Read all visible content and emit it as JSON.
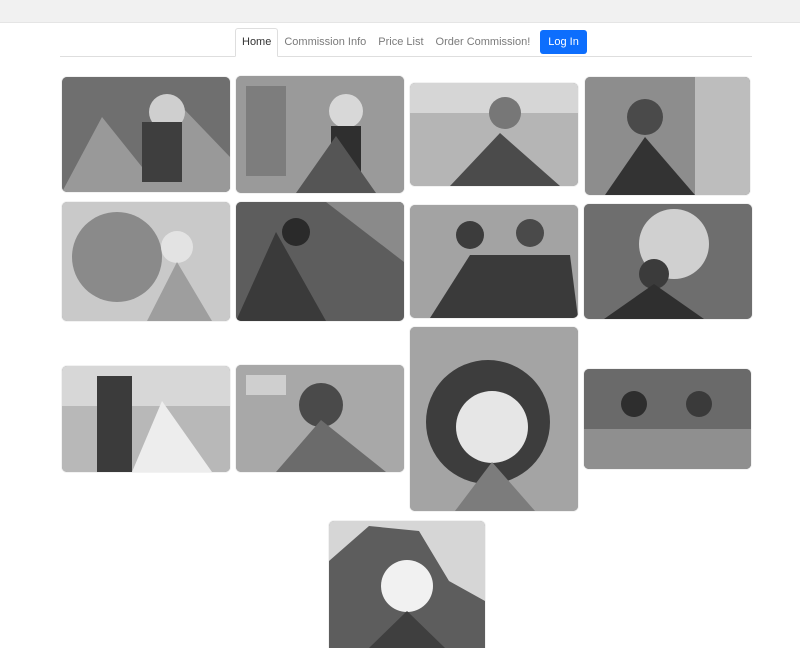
{
  "nav": {
    "items": [
      {
        "label": "Home",
        "active": true
      },
      {
        "label": "Commission Info",
        "active": false
      },
      {
        "label": "Price List",
        "active": false
      },
      {
        "label": "Order Commission!",
        "active": false
      }
    ],
    "login_label": "Log In"
  },
  "colors": {
    "accent": "#0d6efd",
    "nav_text": "#7b7b7b",
    "active_text": "#333333"
  },
  "gallery": {
    "image_count": 13
  }
}
